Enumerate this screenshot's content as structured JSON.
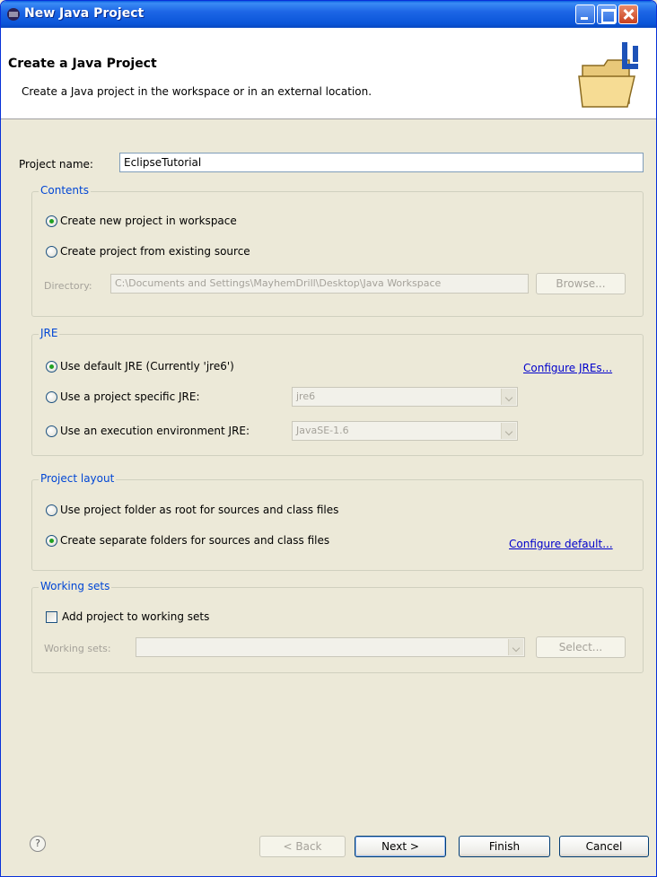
{
  "window": {
    "title": "New Java Project"
  },
  "banner": {
    "heading": "Create a Java Project",
    "subheading": "Create a Java project in the workspace or in an external location."
  },
  "project_name": {
    "label": "Project name:",
    "value": "EclipseTutorial"
  },
  "contents": {
    "title": "Contents",
    "option_new": "Create new project in workspace",
    "option_existing": "Create project from existing source",
    "directory_label": "Directory:",
    "directory_value": "C:\\Documents and Settings\\MayhemDrill\\Desktop\\Java Workspace",
    "browse_label": "Browse..."
  },
  "jre": {
    "title": "JRE",
    "option_default": "Use default JRE (Currently 'jre6')",
    "option_specific": "Use a project specific JRE:",
    "option_environment": "Use an execution environment JRE:",
    "specific_value": "jre6",
    "environment_value": "JavaSE-1.6",
    "configure_link": "Configure JREs..."
  },
  "layout": {
    "title": "Project layout",
    "option_root": "Use project folder as root for sources and class files",
    "option_separate": "Create separate folders for sources and class files",
    "configure_link": "Configure default..."
  },
  "working_sets": {
    "title": "Working sets",
    "add_label": "Add project to working sets",
    "sets_label": "Working sets:",
    "select_label": "Select..."
  },
  "footer": {
    "help_glyph": "?",
    "back_label": "< Back",
    "next_label": "Next >",
    "finish_label": "Finish",
    "cancel_label": "Cancel"
  }
}
